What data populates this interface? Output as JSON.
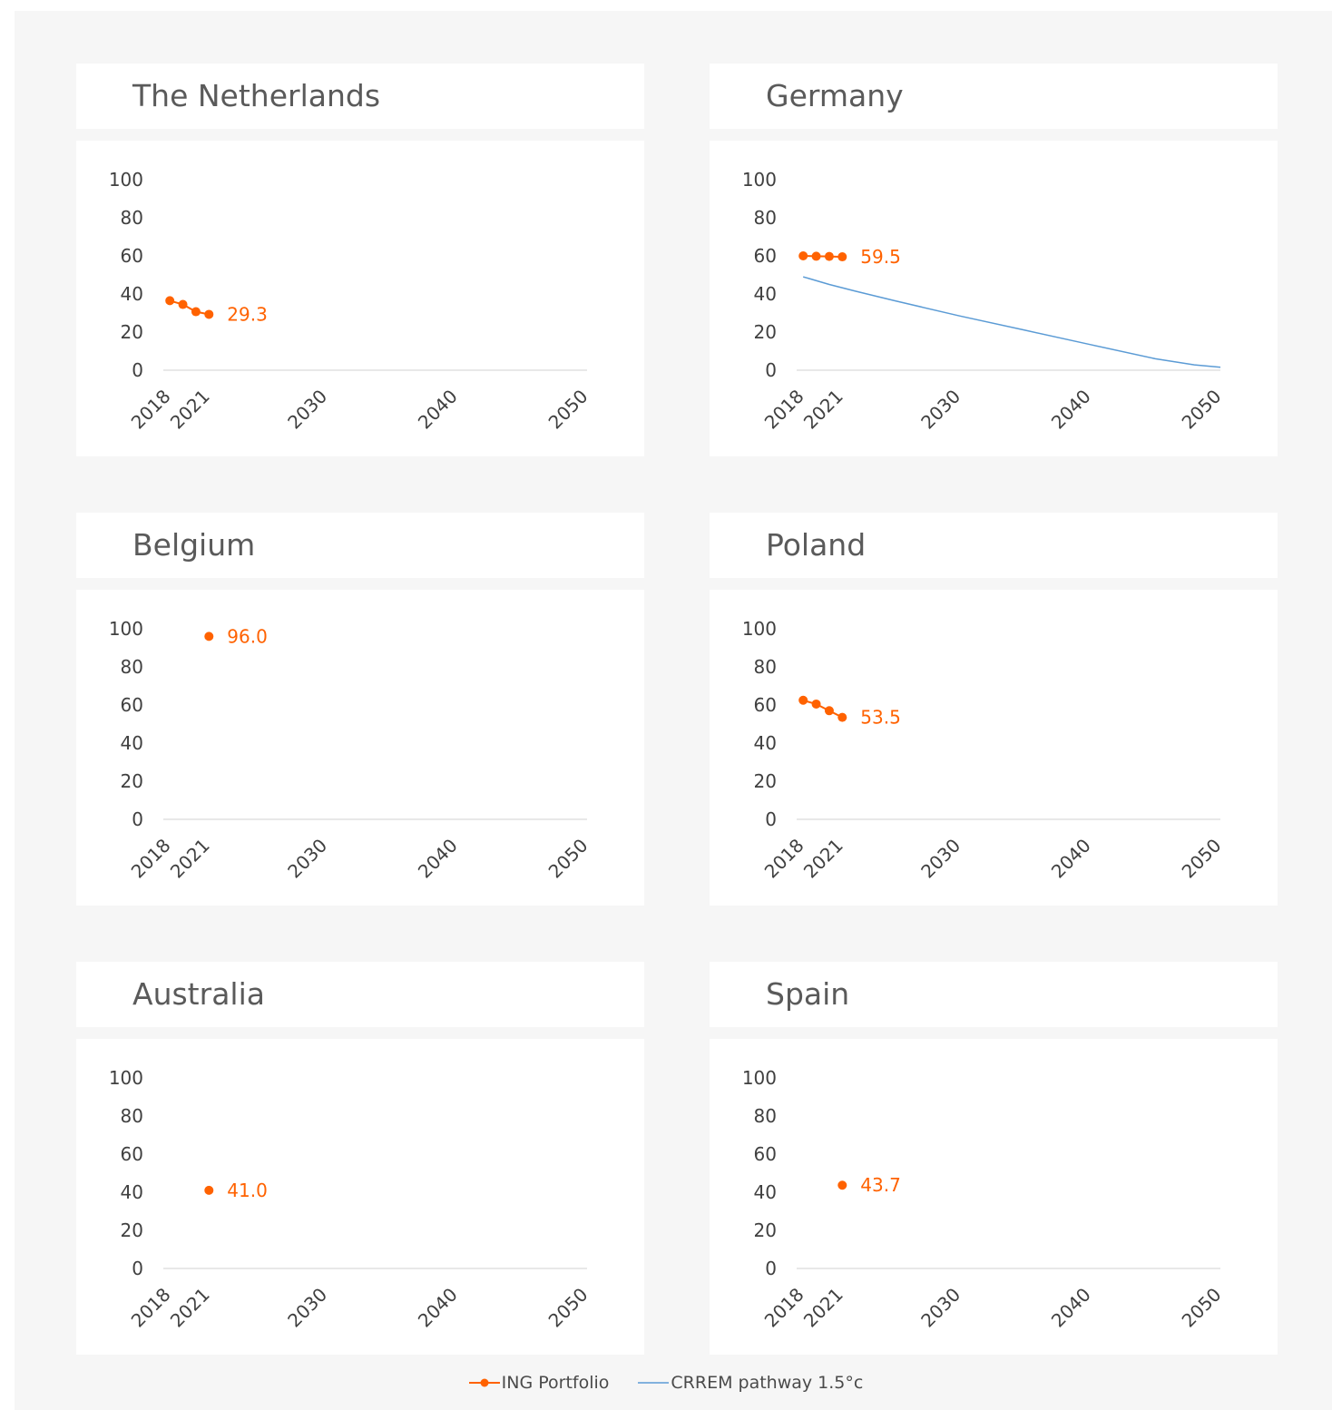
{
  "colors": {
    "portfolio": "#FF6200",
    "pathway": "#5B9BD5",
    "axis": "#d9d9d9",
    "tick_text": "#404040",
    "title_text": "#5a5a5a"
  },
  "legend": {
    "portfolio_label": "ING Portfolio",
    "pathway_label": "CRREM pathway 1.5°c"
  },
  "chart_data": [
    {
      "type": "line",
      "title": "The Netherlands",
      "x_tick_labels": [
        "2018",
        "2021",
        "2030",
        "2040",
        "2050"
      ],
      "x_ticks": [
        2018,
        2021,
        2030,
        2040,
        2050
      ],
      "y_tick_labels": [
        "0",
        "20",
        "40",
        "60",
        "80",
        "100"
      ],
      "ylim": [
        0,
        100
      ],
      "xlim": [
        2017.5,
        2050
      ],
      "series": [
        {
          "name": "ING Portfolio",
          "x": [
            2018,
            2019,
            2020,
            2021
          ],
          "values": [
            36.5,
            34.5,
            30.7,
            29.3
          ],
          "last_label": "29.3"
        }
      ]
    },
    {
      "type": "line",
      "title": "Germany",
      "x_tick_labels": [
        "2018",
        "2021",
        "2030",
        "2040",
        "2050"
      ],
      "x_ticks": [
        2018,
        2021,
        2030,
        2040,
        2050
      ],
      "y_tick_labels": [
        "0",
        "20",
        "40",
        "60",
        "80",
        "100"
      ],
      "ylim": [
        0,
        100
      ],
      "xlim": [
        2017.5,
        2050
      ],
      "series": [
        {
          "name": "ING Portfolio",
          "x": [
            2018,
            2019,
            2020,
            2021
          ],
          "values": [
            60.0,
            59.8,
            59.7,
            59.5
          ],
          "last_label": "59.5"
        },
        {
          "name": "CRREM pathway 1.5°c",
          "x": [
            2018,
            2020,
            2022,
            2025,
            2030,
            2035,
            2040,
            2045,
            2048,
            2050
          ],
          "values": [
            49.0,
            45.0,
            41.5,
            36.5,
            28.5,
            21.0,
            13.5,
            6.0,
            2.8,
            1.5
          ]
        }
      ]
    },
    {
      "type": "line",
      "title": "Belgium",
      "x_tick_labels": [
        "2018",
        "2021",
        "2030",
        "2040",
        "2050"
      ],
      "x_ticks": [
        2018,
        2021,
        2030,
        2040,
        2050
      ],
      "y_tick_labels": [
        "0",
        "20",
        "40",
        "60",
        "80",
        "100"
      ],
      "ylim": [
        0,
        100
      ],
      "xlim": [
        2017.5,
        2050
      ],
      "series": [
        {
          "name": "ING Portfolio",
          "x": [
            2021
          ],
          "values": [
            96.0
          ],
          "last_label": "96.0"
        }
      ]
    },
    {
      "type": "line",
      "title": "Poland",
      "x_tick_labels": [
        "2018",
        "2021",
        "2030",
        "2040",
        "2050"
      ],
      "x_ticks": [
        2018,
        2021,
        2030,
        2040,
        2050
      ],
      "y_tick_labels": [
        "0",
        "20",
        "40",
        "60",
        "80",
        "100"
      ],
      "ylim": [
        0,
        100
      ],
      "xlim": [
        2017.5,
        2050
      ],
      "series": [
        {
          "name": "ING Portfolio",
          "x": [
            2018,
            2019,
            2020,
            2021
          ],
          "values": [
            62.5,
            60.5,
            57.0,
            53.5
          ],
          "last_label": "53.5"
        }
      ]
    },
    {
      "type": "line",
      "title": "Australia",
      "x_tick_labels": [
        "2018",
        "2021",
        "2030",
        "2040",
        "2050"
      ],
      "x_ticks": [
        2018,
        2021,
        2030,
        2040,
        2050
      ],
      "y_tick_labels": [
        "0",
        "20",
        "40",
        "60",
        "80",
        "100"
      ],
      "ylim": [
        0,
        100
      ],
      "xlim": [
        2017.5,
        2050
      ],
      "series": [
        {
          "name": "ING Portfolio",
          "x": [
            2021
          ],
          "values": [
            41.0
          ],
          "last_label": "41.0"
        }
      ]
    },
    {
      "type": "line",
      "title": "Spain",
      "x_tick_labels": [
        "2018",
        "2021",
        "2030",
        "2040",
        "2050"
      ],
      "x_ticks": [
        2018,
        2021,
        2030,
        2040,
        2050
      ],
      "y_tick_labels": [
        "0",
        "20",
        "40",
        "60",
        "80",
        "100"
      ],
      "ylim": [
        0,
        100
      ],
      "xlim": [
        2017.5,
        2050
      ],
      "series": [
        {
          "name": "ING Portfolio",
          "x": [
            2021
          ],
          "values": [
            43.7
          ],
          "last_label": "43.7"
        }
      ]
    }
  ]
}
